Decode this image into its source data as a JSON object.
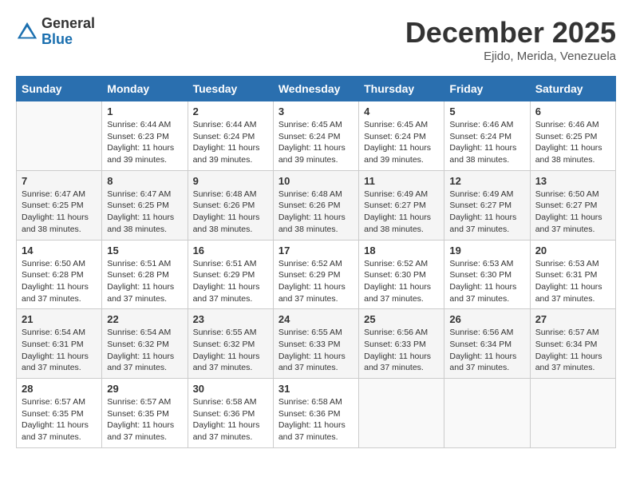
{
  "header": {
    "logo_general": "General",
    "logo_blue": "Blue",
    "month_title": "December 2025",
    "location": "Ejido, Merida, Venezuela"
  },
  "days_of_week": [
    "Sunday",
    "Monday",
    "Tuesday",
    "Wednesday",
    "Thursday",
    "Friday",
    "Saturday"
  ],
  "weeks": [
    [
      {
        "day": "",
        "sunrise": "",
        "sunset": "",
        "daylight": ""
      },
      {
        "day": "1",
        "sunrise": "Sunrise: 6:44 AM",
        "sunset": "Sunset: 6:23 PM",
        "daylight": "Daylight: 11 hours and 39 minutes."
      },
      {
        "day": "2",
        "sunrise": "Sunrise: 6:44 AM",
        "sunset": "Sunset: 6:24 PM",
        "daylight": "Daylight: 11 hours and 39 minutes."
      },
      {
        "day": "3",
        "sunrise": "Sunrise: 6:45 AM",
        "sunset": "Sunset: 6:24 PM",
        "daylight": "Daylight: 11 hours and 39 minutes."
      },
      {
        "day": "4",
        "sunrise": "Sunrise: 6:45 AM",
        "sunset": "Sunset: 6:24 PM",
        "daylight": "Daylight: 11 hours and 39 minutes."
      },
      {
        "day": "5",
        "sunrise": "Sunrise: 6:46 AM",
        "sunset": "Sunset: 6:24 PM",
        "daylight": "Daylight: 11 hours and 38 minutes."
      },
      {
        "day": "6",
        "sunrise": "Sunrise: 6:46 AM",
        "sunset": "Sunset: 6:25 PM",
        "daylight": "Daylight: 11 hours and 38 minutes."
      }
    ],
    [
      {
        "day": "7",
        "sunrise": "Sunrise: 6:47 AM",
        "sunset": "Sunset: 6:25 PM",
        "daylight": "Daylight: 11 hours and 38 minutes."
      },
      {
        "day": "8",
        "sunrise": "Sunrise: 6:47 AM",
        "sunset": "Sunset: 6:25 PM",
        "daylight": "Daylight: 11 hours and 38 minutes."
      },
      {
        "day": "9",
        "sunrise": "Sunrise: 6:48 AM",
        "sunset": "Sunset: 6:26 PM",
        "daylight": "Daylight: 11 hours and 38 minutes."
      },
      {
        "day": "10",
        "sunrise": "Sunrise: 6:48 AM",
        "sunset": "Sunset: 6:26 PM",
        "daylight": "Daylight: 11 hours and 38 minutes."
      },
      {
        "day": "11",
        "sunrise": "Sunrise: 6:49 AM",
        "sunset": "Sunset: 6:27 PM",
        "daylight": "Daylight: 11 hours and 38 minutes."
      },
      {
        "day": "12",
        "sunrise": "Sunrise: 6:49 AM",
        "sunset": "Sunset: 6:27 PM",
        "daylight": "Daylight: 11 hours and 37 minutes."
      },
      {
        "day": "13",
        "sunrise": "Sunrise: 6:50 AM",
        "sunset": "Sunset: 6:27 PM",
        "daylight": "Daylight: 11 hours and 37 minutes."
      }
    ],
    [
      {
        "day": "14",
        "sunrise": "Sunrise: 6:50 AM",
        "sunset": "Sunset: 6:28 PM",
        "daylight": "Daylight: 11 hours and 37 minutes."
      },
      {
        "day": "15",
        "sunrise": "Sunrise: 6:51 AM",
        "sunset": "Sunset: 6:28 PM",
        "daylight": "Daylight: 11 hours and 37 minutes."
      },
      {
        "day": "16",
        "sunrise": "Sunrise: 6:51 AM",
        "sunset": "Sunset: 6:29 PM",
        "daylight": "Daylight: 11 hours and 37 minutes."
      },
      {
        "day": "17",
        "sunrise": "Sunrise: 6:52 AM",
        "sunset": "Sunset: 6:29 PM",
        "daylight": "Daylight: 11 hours and 37 minutes."
      },
      {
        "day": "18",
        "sunrise": "Sunrise: 6:52 AM",
        "sunset": "Sunset: 6:30 PM",
        "daylight": "Daylight: 11 hours and 37 minutes."
      },
      {
        "day": "19",
        "sunrise": "Sunrise: 6:53 AM",
        "sunset": "Sunset: 6:30 PM",
        "daylight": "Daylight: 11 hours and 37 minutes."
      },
      {
        "day": "20",
        "sunrise": "Sunrise: 6:53 AM",
        "sunset": "Sunset: 6:31 PM",
        "daylight": "Daylight: 11 hours and 37 minutes."
      }
    ],
    [
      {
        "day": "21",
        "sunrise": "Sunrise: 6:54 AM",
        "sunset": "Sunset: 6:31 PM",
        "daylight": "Daylight: 11 hours and 37 minutes."
      },
      {
        "day": "22",
        "sunrise": "Sunrise: 6:54 AM",
        "sunset": "Sunset: 6:32 PM",
        "daylight": "Daylight: 11 hours and 37 minutes."
      },
      {
        "day": "23",
        "sunrise": "Sunrise: 6:55 AM",
        "sunset": "Sunset: 6:32 PM",
        "daylight": "Daylight: 11 hours and 37 minutes."
      },
      {
        "day": "24",
        "sunrise": "Sunrise: 6:55 AM",
        "sunset": "Sunset: 6:33 PM",
        "daylight": "Daylight: 11 hours and 37 minutes."
      },
      {
        "day": "25",
        "sunrise": "Sunrise: 6:56 AM",
        "sunset": "Sunset: 6:33 PM",
        "daylight": "Daylight: 11 hours and 37 minutes."
      },
      {
        "day": "26",
        "sunrise": "Sunrise: 6:56 AM",
        "sunset": "Sunset: 6:34 PM",
        "daylight": "Daylight: 11 hours and 37 minutes."
      },
      {
        "day": "27",
        "sunrise": "Sunrise: 6:57 AM",
        "sunset": "Sunset: 6:34 PM",
        "daylight": "Daylight: 11 hours and 37 minutes."
      }
    ],
    [
      {
        "day": "28",
        "sunrise": "Sunrise: 6:57 AM",
        "sunset": "Sunset: 6:35 PM",
        "daylight": "Daylight: 11 hours and 37 minutes."
      },
      {
        "day": "29",
        "sunrise": "Sunrise: 6:57 AM",
        "sunset": "Sunset: 6:35 PM",
        "daylight": "Daylight: 11 hours and 37 minutes."
      },
      {
        "day": "30",
        "sunrise": "Sunrise: 6:58 AM",
        "sunset": "Sunset: 6:36 PM",
        "daylight": "Daylight: 11 hours and 37 minutes."
      },
      {
        "day": "31",
        "sunrise": "Sunrise: 6:58 AM",
        "sunset": "Sunset: 6:36 PM",
        "daylight": "Daylight: 11 hours and 37 minutes."
      },
      {
        "day": "",
        "sunrise": "",
        "sunset": "",
        "daylight": ""
      },
      {
        "day": "",
        "sunrise": "",
        "sunset": "",
        "daylight": ""
      },
      {
        "day": "",
        "sunrise": "",
        "sunset": "",
        "daylight": ""
      }
    ]
  ]
}
